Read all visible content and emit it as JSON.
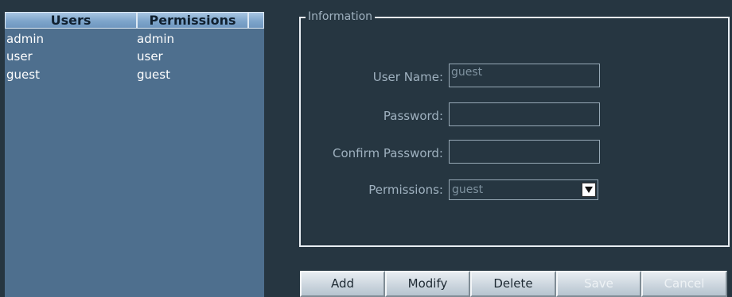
{
  "users_table": {
    "columns": [
      "Users",
      "Permissions"
    ],
    "rows": [
      {
        "user": "admin",
        "permission": "admin"
      },
      {
        "user": "user",
        "permission": "user"
      },
      {
        "user": "guest",
        "permission": "guest"
      }
    ]
  },
  "info": {
    "legend": "Information",
    "username": {
      "label": "User Name:",
      "value": "guest"
    },
    "password": {
      "label": "Password:",
      "value": ""
    },
    "confirm_password": {
      "label": "Confirm Password:",
      "value": ""
    },
    "permissions": {
      "label": "Permissions:",
      "selected": "guest",
      "dropdown_icon": "chevron-down-icon"
    }
  },
  "buttons": {
    "add": "Add",
    "modify": "Modify",
    "delete": "Delete",
    "save": "Save",
    "cancel": "Cancel"
  }
}
